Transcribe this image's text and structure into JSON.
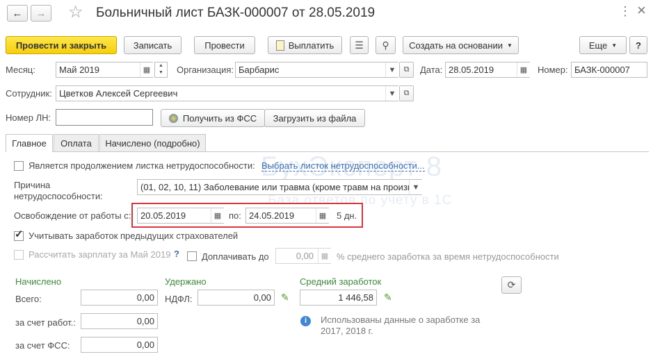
{
  "window": {
    "title": "Больничный лист БАЗК-000007 от 28.05.2019",
    "back_icon": "←",
    "forward_icon": "→",
    "star_icon": "☆",
    "close_icon": "×",
    "more_icon": "⋮"
  },
  "toolbar": {
    "post_close": "Провести и закрыть",
    "save": "Записать",
    "post": "Провести",
    "pay": "Выплатить",
    "create_based": "Создать на основании",
    "more": "Еще",
    "help": "?"
  },
  "header": {
    "month_label": "Месяц:",
    "month_value": "Май 2019",
    "org_label": "Организация:",
    "org_value": "Барбарис",
    "date_label": "Дата:",
    "date_value": "28.05.2019",
    "number_label": "Номер:",
    "number_value": "БАЗК-000007",
    "employee_label": "Сотрудник:",
    "employee_value": "Цветков Алексей Сергеевич",
    "ln_label": "Номер ЛН:",
    "ln_value": "",
    "fss_button": "Получить из ФСС",
    "file_button": "Загрузить из файла"
  },
  "tabs": [
    "Главное",
    "Оплата",
    "Начислено (подробно)"
  ],
  "main": {
    "continuation_label": "Является продолжением листка нетрудоспособности:",
    "choose_sheet_link": "Выбрать листок нетрудоспособности...",
    "reason_label_1": "Причина",
    "reason_label_2": "нетрудоспособности:",
    "reason_value": "(01, 02, 10, 11) Заболевание или травма (кроме травм на произв",
    "release_label": "Освобождение от работы с:",
    "release_from": "20.05.2019",
    "to_label": "по:",
    "release_to": "24.05.2019",
    "days": "5 дн.",
    "prev_insurers_label": "Учитывать заработок предыдущих страхователей",
    "calc_salary_label": "Рассчитать зарплату за Май 2019",
    "help_mark": "?",
    "topup_label": "Доплачивать до",
    "topup_value": "0,00",
    "topup_suffix": "% среднего заработка за время нетрудоспособности"
  },
  "accrued": {
    "heading": "Начислено",
    "total_label": "Всего:",
    "total_value": "0,00",
    "employer_label": "за счет работ.:",
    "employer_value": "0,00",
    "fss_label": "за счет ФСС:",
    "fss_value": "0,00"
  },
  "withheld": {
    "heading": "Удержано",
    "ndfl_label": "НДФЛ:",
    "ndfl_value": "0,00"
  },
  "average": {
    "heading": "Средний заработок",
    "value": "1 446,58",
    "info_text_1": "Использованы данные о заработке за",
    "info_text_2": "2017,  2018 г."
  },
  "watermark": {
    "brand": "БухЭксперт 8",
    "tagline": "База ответов по учету в 1С"
  },
  "colors": {
    "primary": "#f5cf0e",
    "highlight_box": "#d9363e",
    "link": "#3b6db8",
    "section_heading": "#3c8c3c"
  }
}
